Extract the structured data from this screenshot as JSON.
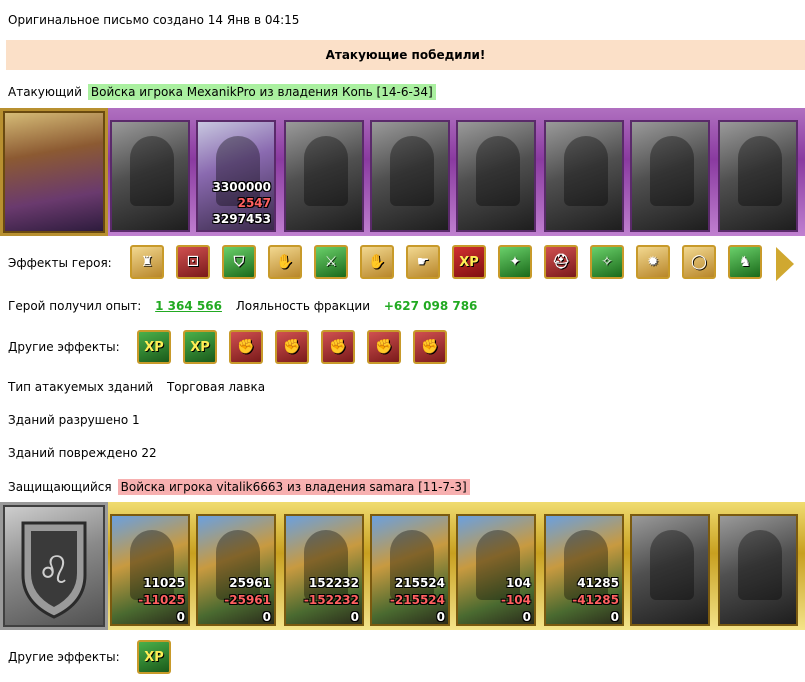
{
  "header": {
    "original_letter": "Оригинальное письмо создано 14 Янв в 04:15"
  },
  "result": {
    "title": "Атакующие победили!"
  },
  "attacker": {
    "label": "Атакующий",
    "army_name": "Войска игрока MexanikPro из владения Копь [14-6-34]",
    "portrait_icon": "hero-portrait-female-knight",
    "units": [
      {
        "icon": "unit-armored-golem"
      },
      {
        "icon": "unit-dark-mage",
        "count": "3300000",
        "lost": "2547",
        "remaining": "3297453"
      },
      {
        "icon": "unit-knight-on-horse"
      },
      {
        "icon": "unit-winged-griffin"
      },
      {
        "icon": "unit-archer"
      },
      {
        "icon": "unit-robed-lord"
      },
      {
        "icon": "unit-skeleton-warrior"
      },
      {
        "icon": "unit-war-machine"
      }
    ]
  },
  "hero_effects": {
    "label": "Эффекты героя:",
    "icons": [
      "fortress-icon",
      "dice-attack-icon",
      "shield-icon",
      "handshake-icon",
      "sword-icon",
      "handshake-icon",
      "healing-hand-icon",
      "xp-icon",
      "xp-bonus-icon",
      "helmet-icon",
      "amulet-icon",
      "claws-icon",
      "ring-icon",
      "boots-icon"
    ],
    "xp_text": "XP"
  },
  "experience": {
    "label": "Герой получил опыт:",
    "value": "1 364 566",
    "loyalty_label": "Лояльность фракции",
    "loyalty_value": "+627 098 786"
  },
  "other_effects_att": {
    "label": "Другие эффекты:",
    "icons": [
      "xp-icon",
      "xp-icon",
      "fist-sword-icon",
      "fist-sword-icon",
      "fist-sword-icon",
      "fist-sword-icon",
      "fist-sword-icon"
    ],
    "xp_text": "XP"
  },
  "buildings": {
    "type_label": "Тип атакуемых зданий",
    "type_value": "Торговая лавка",
    "destroyed": "Зданий разрушено  1",
    "damaged": "Зданий повреждено  22"
  },
  "defender": {
    "label": "Защищающийся",
    "army_name": "Войска игрока vitalik6663 из владения samara [11-7-3]",
    "portrait_icon": "lion-shield-crest",
    "units": [
      {
        "icon": "unit-camel-rider",
        "count": "11025",
        "lost": "-11025",
        "remaining": "0"
      },
      {
        "icon": "unit-golden-knight",
        "count": "25961",
        "lost": "-25961",
        "remaining": "0"
      },
      {
        "icon": "unit-cavalry",
        "count": "152232",
        "lost": "-152232",
        "remaining": "0"
      },
      {
        "icon": "unit-griffin-rider",
        "count": "215524",
        "lost": "-215524",
        "remaining": "0"
      },
      {
        "icon": "unit-crossbowman",
        "count": "104",
        "lost": "-104",
        "remaining": "0"
      },
      {
        "icon": "unit-priest",
        "count": "41285",
        "lost": "-41285",
        "remaining": "0"
      },
      {
        "icon": "unit-ogre"
      },
      {
        "icon": "unit-wraith"
      }
    ]
  },
  "other_effects_def": {
    "label": "Другие эффекты:",
    "icons": [
      "xp-icon"
    ],
    "xp_text": "XP"
  }
}
